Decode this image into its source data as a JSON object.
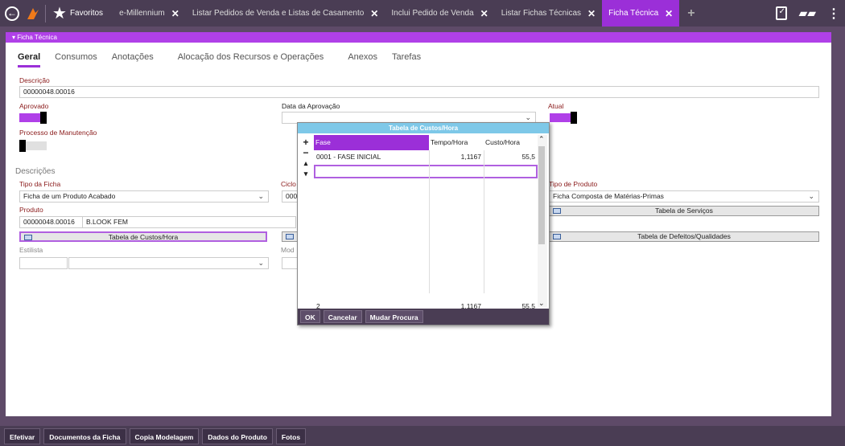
{
  "topbar": {
    "favorites_label": "Favoritos",
    "tabs": [
      {
        "label": "e-Millennium"
      },
      {
        "label": "Listar Pedidos de Venda e Listas de Casamento"
      },
      {
        "label": "Inclui Pedido de Venda"
      },
      {
        "label": "Listar Fichas Técnicas"
      },
      {
        "label": "Ficha Técnica"
      }
    ],
    "close_glyph": "✕",
    "add_glyph": "+"
  },
  "section_header": "▾ Ficha Técnica",
  "subtabs": [
    "Geral",
    "Consumos",
    "Anotações",
    "Alocação dos Recursos e Operações",
    "Anexos",
    "Tarefas"
  ],
  "form": {
    "descricao_label": "Descrição",
    "descricao_value": "00000048.00016",
    "aprovado_label": "Aprovado",
    "data_aprovacao_label": "Data da Aprovação",
    "atual_label": "Atual",
    "processo_manutencao_label": "Processo de Manutenção",
    "descricoes_title": "Descrições",
    "tipo_ficha_label": "Tipo da Ficha",
    "tipo_ficha_value": "Ficha de um Produto Acabado",
    "ciclo_label": "Ciclo",
    "ciclo_value": "000",
    "tipo_produto_label": "Tipo de Produto",
    "tipo_produto_value": "Ficha Composta de Matérias-Primas",
    "produto_label": "Produto",
    "produto_code": "00000048.00016",
    "produto_name": "B.LOOK FEM",
    "tabela_servicos_btn": "Tabela de Serviços",
    "tabela_custos_btn": "Tabela de Custos/Hora",
    "tabela_defeitos_btn": "Tabela de Defeitos/Qualidades",
    "estilista_label": "Estilista",
    "modelista_label": "Mod"
  },
  "dialog": {
    "title": "Tabela de Custos/Hora",
    "side_buttons": [
      "+",
      "−",
      "▴",
      "▾"
    ],
    "columns": [
      "Fase",
      "Tempo/Hora",
      "Custo/Hora"
    ],
    "rows": [
      {
        "fase": "0001 - FASE INICIAL",
        "tempo": "1,1167",
        "custo": "55,5"
      }
    ],
    "footer": {
      "count": "2",
      "tempo": "1,1167",
      "custo": "55,5"
    },
    "buttons": [
      "OK",
      "Cancelar",
      "Mudar Procura"
    ]
  },
  "bottombar": {
    "buttons": [
      "Efetivar",
      "Documentos da Ficha",
      "Copia Modelagem",
      "Dados do Produto",
      "Fotos"
    ]
  },
  "colors": {
    "accent": "#9b2fd8",
    "topbar": "#4a3d54",
    "dialog_title": "#7ec8e8"
  }
}
